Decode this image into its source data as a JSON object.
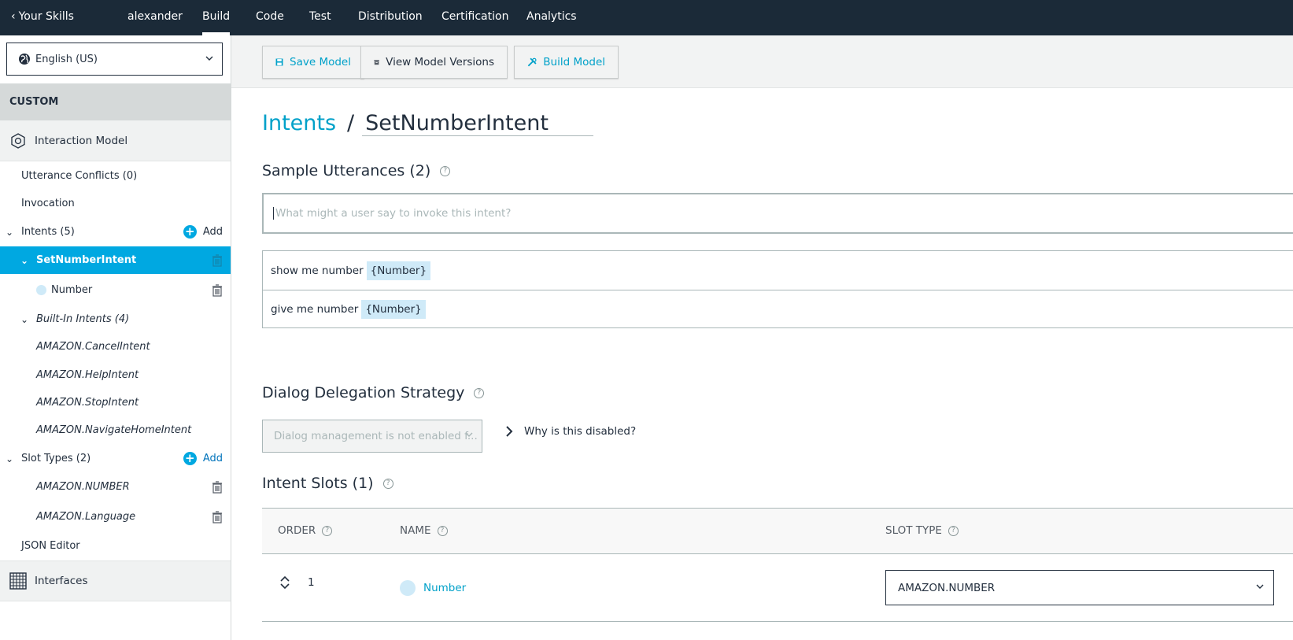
{
  "topnav": {
    "back_label": "Your Skills",
    "tabs": [
      {
        "label": "alexander"
      },
      {
        "label": "Build"
      },
      {
        "label": "Code"
      },
      {
        "label": "Test"
      },
      {
        "label": "Distribution"
      },
      {
        "label": "Certification"
      },
      {
        "label": "Analytics"
      }
    ],
    "active_tab": "Build"
  },
  "sidebar": {
    "locale": "English (US)",
    "section_header": "CUSTOM",
    "interaction_model_label": "Interaction Model",
    "utterance_conflicts": "Utterance Conflicts (0)",
    "invocation": "Invocation",
    "intents_label": "Intents (5)",
    "add_label": "Add",
    "selected_intent": "SetNumberIntent",
    "intent_slot": "Number",
    "builtin_label": "Built-In Intents (4)",
    "builtin_intents": [
      "AMAZON.CancelIntent",
      "AMAZON.HelpIntent",
      "AMAZON.StopIntent",
      "AMAZON.NavigateHomeIntent"
    ],
    "slot_types_label": "Slot Types (2)",
    "slot_types": [
      "AMAZON.NUMBER",
      "AMAZON.Language"
    ],
    "json_editor": "JSON Editor",
    "interfaces_label": "Interfaces"
  },
  "toolbar": {
    "save_label": "Save Model",
    "versions_label": "View Model Versions",
    "build_label": "Build Model"
  },
  "main": {
    "breadcrumb_link": "Intents",
    "breadcrumb_sep": "/",
    "intent_name": "SetNumberIntent",
    "utterances_title": "Sample Utterances (2)",
    "utterance_placeholder": "What might a user say to invoke this intent?",
    "utterances": [
      {
        "text": "show me number",
        "slot": "{Number}"
      },
      {
        "text": "give me number",
        "slot": "{Number}"
      }
    ],
    "dialog_title": "Dialog Delegation Strategy",
    "dialog_select": "Dialog management is not enabled f...",
    "why_disabled": "Why is this disabled?",
    "slots_title": "Intent Slots (1)",
    "slots_columns": {
      "order": "ORDER",
      "name": "NAME",
      "type": "SLOT TYPE"
    },
    "slots": [
      {
        "order": "1",
        "name": "Number",
        "type": "AMAZON.NUMBER"
      }
    ],
    "help_glyph": "?"
  },
  "colors": {
    "nav_bg": "#1b2a38",
    "accent": "#00a8e1",
    "link": "#00a1c9",
    "slot_chip": "#cfeaf8"
  }
}
